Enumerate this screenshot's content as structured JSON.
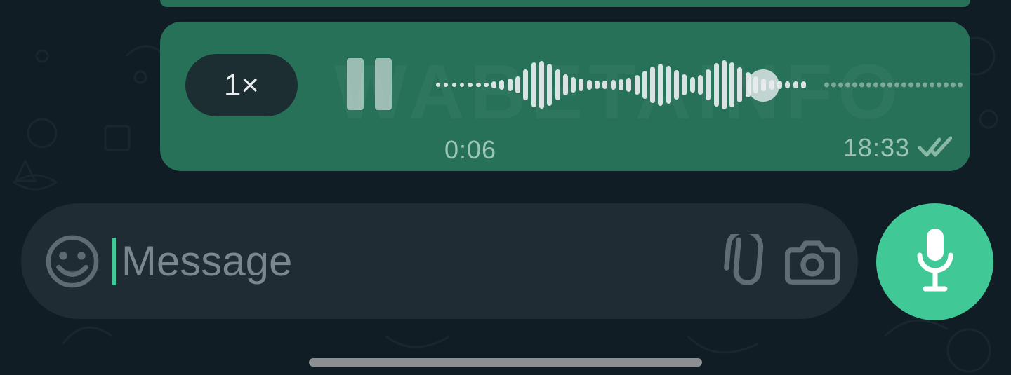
{
  "message": {
    "playback_speed_label": "1×",
    "elapsed": "0:06",
    "timestamp": "18:33",
    "status": "read",
    "watermark_text": "WABETAINFO",
    "waveform": {
      "played": [
        6,
        6,
        6,
        10,
        14,
        18,
        24,
        44,
        64,
        68,
        60,
        44,
        30,
        22,
        18,
        14,
        12,
        12,
        14,
        16,
        20,
        28,
        40,
        52,
        60,
        54,
        42,
        30,
        22,
        28,
        44,
        62,
        70,
        64,
        50,
        36,
        24,
        18,
        14,
        12,
        10,
        10,
        10
      ],
      "unplayed_count": 20
    }
  },
  "composer": {
    "placeholder": "Message",
    "value": ""
  },
  "colors": {
    "outgoing_bubble": "#267158",
    "composer_bg": "#1f2c33",
    "accent": "#40c996",
    "chat_bg": "#101d25"
  }
}
